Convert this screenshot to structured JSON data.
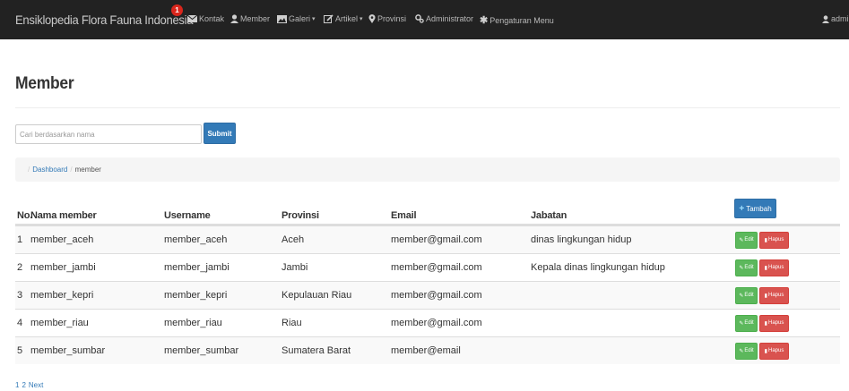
{
  "navbar": {
    "brand": "Ensiklopedia Flora Fauna Indonesia",
    "notification_count": "1",
    "items": [
      {
        "label": "Kontak",
        "icon": "envelope-icon"
      },
      {
        "label": "Member",
        "icon": "user-icon"
      },
      {
        "label": "Galeri",
        "icon": "image-icon",
        "dropdown": true
      },
      {
        "label": "Artikel",
        "icon": "edit-icon",
        "dropdown": true
      },
      {
        "label": "Provinsi",
        "icon": "map-marker-icon"
      },
      {
        "label": "Administrator",
        "icon": "cogs-icon"
      },
      {
        "label": "Pengaturan Menu",
        "icon": "asterisk-icon"
      }
    ],
    "user": "admin"
  },
  "page": {
    "title": "Member"
  },
  "search": {
    "placeholder": "Cari berdasarkan nama",
    "value": "",
    "submit_label": "Submit"
  },
  "breadcrumb": {
    "items": [
      "Dashboard",
      "member"
    ]
  },
  "table": {
    "headers": [
      "No.",
      "Nama member",
      "Username",
      "Provinsi",
      "Email",
      "Jabatan"
    ],
    "add_label": "Tambah",
    "edit_label": "Edit",
    "delete_label": "Hapus",
    "rows": [
      {
        "no": "1",
        "nama": "member_aceh",
        "username": "member_aceh",
        "provinsi": "Aceh",
        "email": "member@gmail.com",
        "jabatan": "dinas lingkungan hidup"
      },
      {
        "no": "2",
        "nama": "member_jambi",
        "username": "member_jambi",
        "provinsi": "Jambi",
        "email": "member@gmail.com",
        "jabatan": "Kepala dinas lingkungan hidup"
      },
      {
        "no": "3",
        "nama": "member_kepri",
        "username": "member_kepri",
        "provinsi": "Kepulauan Riau",
        "email": "member@gmail.com",
        "jabatan": ""
      },
      {
        "no": "4",
        "nama": "member_riau",
        "username": "member_riau",
        "provinsi": "Riau",
        "email": "member@gmail.com",
        "jabatan": ""
      },
      {
        "no": "5",
        "nama": "member_sumbar",
        "username": "member_sumbar",
        "provinsi": "Sumatera Barat",
        "email": "member@email",
        "jabatan": ""
      }
    ]
  },
  "pagination": {
    "pages": [
      "1",
      "2"
    ],
    "next_label": "Next"
  },
  "colors": {
    "navbar_bg": "#222222",
    "primary": "#337ab7",
    "success": "#5cb85c",
    "danger": "#d9534f",
    "badge": "#d9261c"
  }
}
